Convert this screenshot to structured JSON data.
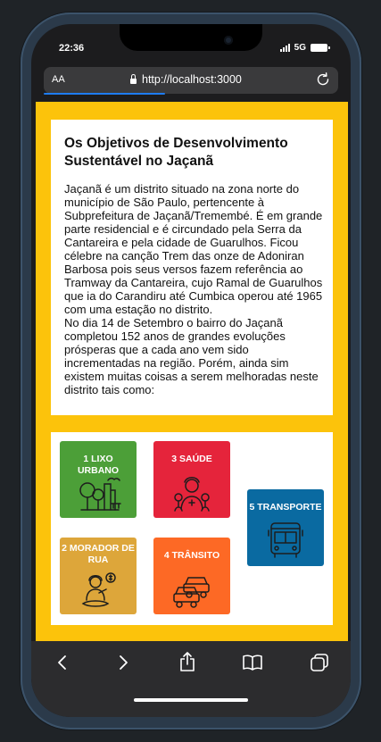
{
  "status": {
    "time": "22:36",
    "network": "5G"
  },
  "browser": {
    "aa_label": "AA",
    "url": "http://localhost:3000"
  },
  "page": {
    "title": "Os Objetivos de Desenvolvimento Sustentável no Jaçanã",
    "paragraphs": [
      "Jaçanã é um distrito situado na zona norte do município de São Paulo, pertencente à Subprefeitura de Jaçanã/Tremembé. É em grande parte residencial e é circundado pela Serra da Cantareira e pela cidade de Guarulhos. Ficou célebre na canção Trem das onze de Adoniran Barbosa pois seus versos fazem referência ao Tramway da Cantareira, cujo Ramal de Guarulhos que ia do Carandiru até Cumbica operou até 1965 com uma estação no distrito.",
      "No dia 14 de Setembro o bairro do Jaçanã completou 152 anos de grandes evoluções prósperas que a cada ano vem sido incrementadas na região. Porém, ainda sim existem muitas coisas a serem melhoradas neste distrito tais como:"
    ],
    "background_color": "#fcc30b"
  },
  "goals": [
    {
      "label": "1 LIXO URBANO",
      "color": "#4c9f38",
      "icon": "city-park-icon"
    },
    {
      "label": "3 SAÚDE",
      "color": "#e5243b",
      "icon": "health-worker-icon"
    },
    {
      "label": "5 TRANSPORTE",
      "color": "#0a6aa1",
      "icon": "bus-icon"
    },
    {
      "label": "2 MORADOR DE RUA",
      "color": "#dda63a",
      "icon": "homeless-person-icon"
    },
    {
      "label": "4 TRÂNSITO",
      "color": "#fd6925",
      "icon": "traffic-cars-icon"
    }
  ],
  "toolbar": [
    "back-icon",
    "forward-icon",
    "share-icon",
    "bookmarks-icon",
    "tabs-icon"
  ]
}
